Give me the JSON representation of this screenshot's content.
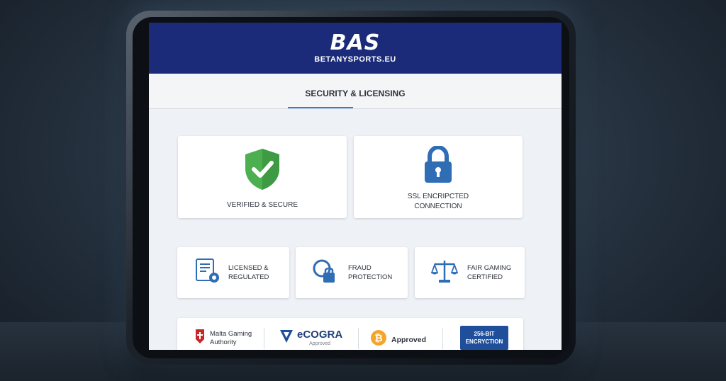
{
  "header": {
    "logo_mark": "BAS",
    "logo_text": "BETANYSPORTS.EU",
    "brand_color": "#1b2b7a"
  },
  "section_title": "SECURITY & LICENSING",
  "feature_cards": [
    {
      "icon": "shield-check-icon",
      "label": "VERIFIED & SECURE"
    },
    {
      "icon": "padlock-icon",
      "label_line1": "SSL ENCRIPCTED",
      "label_line2": "CONNECTION"
    }
  ],
  "small_cards": [
    {
      "icon": "certificate-gear-icon",
      "label_line1": "LICENSED &",
      "label_line2": "REGULATED"
    },
    {
      "icon": "search-lock-icon",
      "label_line1": "FRAUD",
      "label_line2": "PROTECTION"
    },
    {
      "icon": "scales-icon",
      "label_line1": "FAIR GAMING",
      "label_line2": "CERTIFIED"
    }
  ],
  "badges": {
    "malta_line1": "Malta Gaming",
    "malta_line2": "Authority",
    "ecogra": "eCOGRA",
    "ecogra_sub": "Approved",
    "bitcoin": "Approved",
    "encryption_line1": "256-BIT",
    "encryption_line2": "ENCRYCTION"
  },
  "colors": {
    "accent": "#3a7bd5",
    "shield_green": "#4caf50",
    "icon_blue": "#2f6db5"
  }
}
